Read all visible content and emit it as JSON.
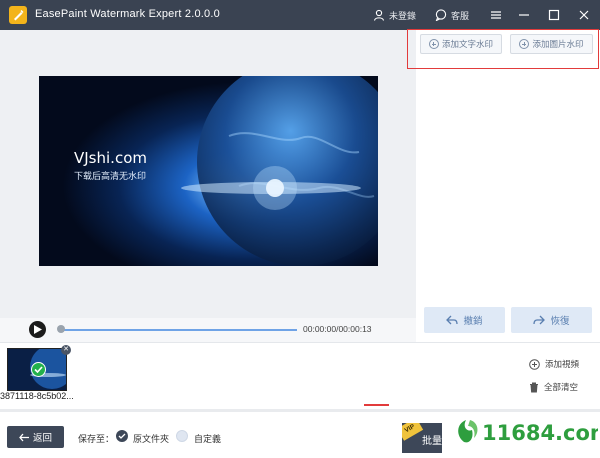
{
  "window": {
    "title": "EasePaint Watermark Expert  2.0.0.0",
    "user_label": "未登錄",
    "service_label": "客服"
  },
  "right_panel": {
    "add_text_watermark": "添加文字水印",
    "add_image_watermark": "添加圖片水印",
    "undo": "撤銷",
    "redo": "恢復"
  },
  "preview": {
    "brand": "VJshi.com",
    "caption": "下载后高清无水印"
  },
  "player": {
    "time": "00:00:00/00:00:13",
    "progress": 0.0
  },
  "clips": {
    "items": [
      {
        "name": "3871118-8c5b02..."
      }
    ],
    "add_video": "添加視頻",
    "clear_all": "全部清空"
  },
  "bottom": {
    "back": "返回",
    "save_to": "保存至：",
    "option_original": "原文件夾",
    "option_custom": "自定義",
    "batch": "批量",
    "vip": "VIP"
  },
  "overlay": {
    "site_logo": "11684.com"
  },
  "colors": {
    "titlebar": "#3a4352",
    "accent": "#6fa3e6",
    "highlight": "#e23b3b",
    "logo_green": "#2e9e3e"
  }
}
